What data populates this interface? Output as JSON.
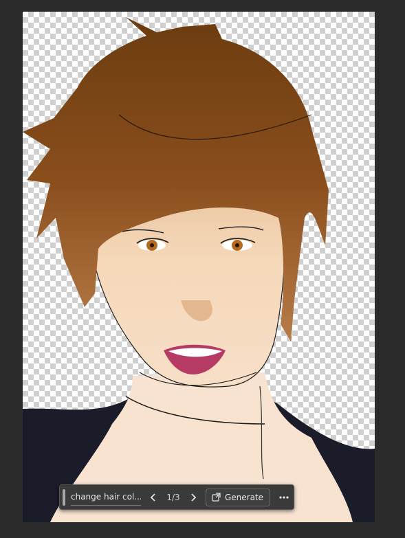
{
  "canvas": {
    "image_description": "digital painting: face with brown hair on transparent background"
  },
  "taskbar": {
    "prompt_text": "change hair col...",
    "prev_icon": "chevron-left-icon",
    "counter": "1/3",
    "next_icon": "chevron-right-icon",
    "generate_icon": "generate-icon",
    "generate_label": "Generate",
    "more_icon": "more-icon"
  },
  "colors": {
    "app_background": "#2b2b2b",
    "taskbar_background": "#3a3a3a",
    "hair": "#7a4514",
    "skin": "#f3d6b8",
    "lips": "#b53a64"
  }
}
